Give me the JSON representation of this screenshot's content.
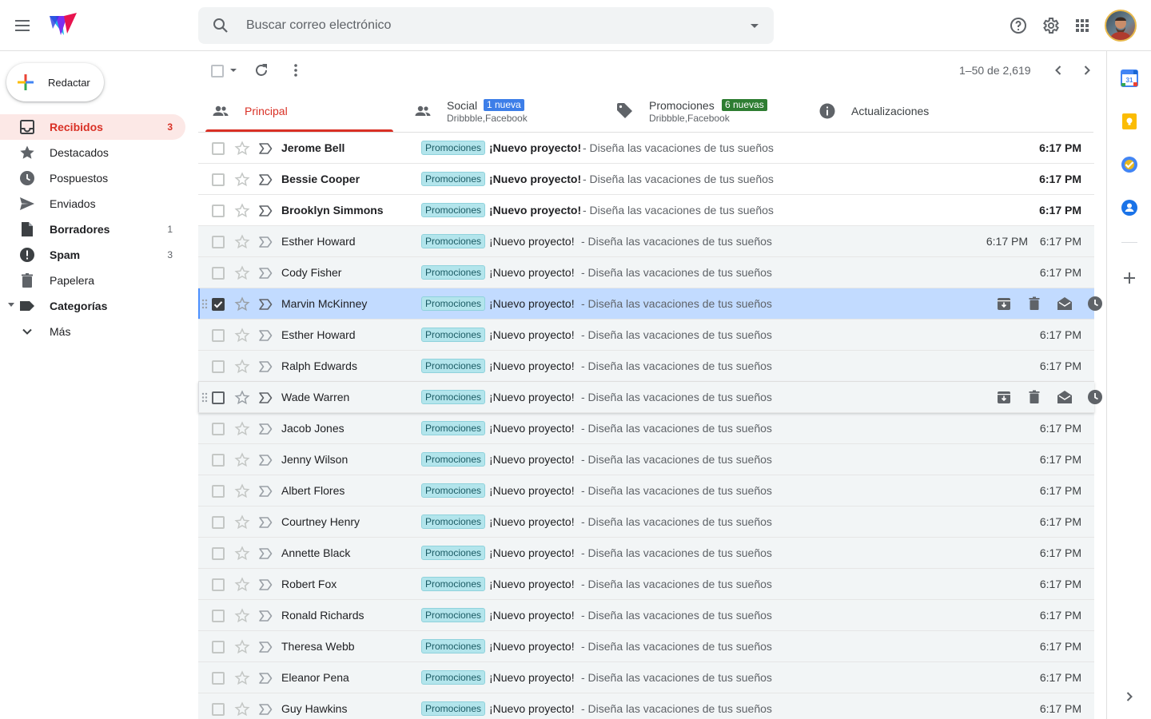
{
  "header": {
    "search_placeholder": "Buscar correo electrónico",
    "icons": [
      "menu-icon",
      "app-logo",
      "search-icon",
      "search-options-icon",
      "help-icon",
      "settings-icon",
      "apps-icon",
      "avatar"
    ]
  },
  "compose": {
    "label": "Redactar"
  },
  "nav": {
    "items": [
      {
        "label": "Recibidos",
        "count": "3",
        "icon": "inbox-icon",
        "active": true
      },
      {
        "label": "Destacados",
        "count": "",
        "icon": "star-icon"
      },
      {
        "label": "Pospuestos",
        "count": "",
        "icon": "clock-icon"
      },
      {
        "label": "Enviados",
        "count": "",
        "icon": "send-icon"
      },
      {
        "label": "Borradores",
        "count": "1",
        "icon": "draft-icon",
        "bold": true
      },
      {
        "label": "Spam",
        "count": "3",
        "icon": "spam-icon",
        "bold": true
      },
      {
        "label": "Papelera",
        "count": "",
        "icon": "trash-icon"
      },
      {
        "label": "Categorías",
        "count": "",
        "icon": "label-icon",
        "bold": true
      },
      {
        "label": "Más",
        "count": "",
        "icon": "expand-more-icon"
      }
    ]
  },
  "toolbar": {
    "pagination": "1–50 de 2,619"
  },
  "tabs": [
    {
      "label": "Principal",
      "sub": "",
      "badge": "",
      "icon": "people-icon",
      "active": true
    },
    {
      "label": "Social",
      "sub": "Dribbble,Facebook",
      "badge": "1 nueva",
      "badge_color": "#3d7ee8",
      "icon": "people-icon"
    },
    {
      "label": "Promociones",
      "sub": "Dribbble,Facebook",
      "badge": "6 nuevas",
      "badge_color": "#2e7d32",
      "icon": "tag-icon"
    },
    {
      "label": "Actualizaciones",
      "sub": "",
      "badge": "",
      "icon": "info-icon"
    }
  ],
  "emails": [
    {
      "sender": "Jerome Bell",
      "label": "Promociones",
      "subject": "¡Nuevo proyecto!",
      "snippet": "- Diseña las vacaciones de tus sueños",
      "time": "6:17 PM",
      "unread": true
    },
    {
      "sender": "Bessie Cooper",
      "label": "Promociones",
      "subject": "¡Nuevo proyecto!",
      "snippet": "- Diseña las vacaciones de tus sueños",
      "time": "6:17 PM",
      "unread": true
    },
    {
      "sender": "Brooklyn Simmons",
      "label": "Promociones",
      "subject": "¡Nuevo proyecto!",
      "snippet": "- Diseña las vacaciones de tus sueños",
      "time": "6:17 PM",
      "unread": true
    },
    {
      "sender": "Esther Howard",
      "label": "Promociones",
      "subject": "¡Nuevo proyecto!",
      "snippet": "- Diseña las vacaciones de tus sueños",
      "time": "6:17 PM",
      "time2": "6:17 PM"
    },
    {
      "sender": "Cody Fisher",
      "label": "Promociones",
      "subject": "¡Nuevo proyecto!",
      "snippet": "- Diseña las vacaciones de tus sueños",
      "time": "6:17 PM"
    },
    {
      "sender": "Marvin McKinney",
      "label": "Promociones",
      "subject": "¡Nuevo proyecto!",
      "snippet": "- Diseña las vacaciones de tus sueños",
      "time": "",
      "selected": true,
      "actions": true
    },
    {
      "sender": "Esther Howard",
      "label": "Promociones",
      "subject": "¡Nuevo proyecto!",
      "snippet": "- Diseña las vacaciones de tus sueños",
      "time": "6:17 PM"
    },
    {
      "sender": "Ralph Edwards",
      "label": "Promociones",
      "subject": "¡Nuevo proyecto!",
      "snippet": "- Diseña las vacaciones de tus sueños",
      "time": "6:17 PM"
    },
    {
      "sender": "Wade Warren",
      "label": "Promociones",
      "subject": "¡Nuevo proyecto!",
      "snippet": "- Diseña las vacaciones de tus sueños",
      "time": "",
      "hover": true,
      "actions": true
    },
    {
      "sender": "Jacob Jones",
      "label": "Promociones",
      "subject": "¡Nuevo proyecto!",
      "snippet": "- Diseña las vacaciones de tus sueños",
      "time": "6:17 PM"
    },
    {
      "sender": "Jenny Wilson",
      "label": "Promociones",
      "subject": "¡Nuevo proyecto!",
      "snippet": "- Diseña las vacaciones de tus sueños",
      "time": "6:17 PM"
    },
    {
      "sender": "Albert Flores",
      "label": "Promociones",
      "subject": "¡Nuevo proyecto!",
      "snippet": "- Diseña las vacaciones de tus sueños",
      "time": "6:17 PM"
    },
    {
      "sender": "Courtney Henry",
      "label": "Promociones",
      "subject": "¡Nuevo proyecto!",
      "snippet": "- Diseña las vacaciones de tus sueños",
      "time": "6:17 PM"
    },
    {
      "sender": "Annette Black",
      "label": "Promociones",
      "subject": "¡Nuevo proyecto!",
      "snippet": "- Diseña las vacaciones de tus sueños",
      "time": "6:17 PM"
    },
    {
      "sender": "Robert Fox",
      "label": "Promociones",
      "subject": "¡Nuevo proyecto!",
      "snippet": "- Diseña las vacaciones de tus sueños",
      "time": "6:17 PM"
    },
    {
      "sender": "Ronald Richards",
      "label": "Promociones",
      "subject": "¡Nuevo proyecto!",
      "snippet": "- Diseña las vacaciones de tus sueños",
      "time": "6:17 PM"
    },
    {
      "sender": "Theresa Webb",
      "label": "Promociones",
      "subject": "¡Nuevo proyecto!",
      "snippet": "- Diseña las vacaciones de tus sueños",
      "time": "6:17 PM"
    },
    {
      "sender": "Eleanor Pena",
      "label": "Promociones",
      "subject": "¡Nuevo proyecto!",
      "snippet": "- Diseña las vacaciones de tus sueños",
      "time": "6:17 PM"
    },
    {
      "sender": "Guy Hawkins",
      "label": "Promociones",
      "subject": "¡Nuevo proyecto!",
      "snippet": "- Diseña las vacaciones de tus sueños",
      "time": "6:17 PM"
    }
  ],
  "side_panel": {
    "icons": [
      "calendar-icon",
      "keep-icon",
      "tasks-icon",
      "contacts-icon",
      "add-icon",
      "expand-panel-icon"
    ],
    "calendar_day": "31"
  },
  "colors": {
    "accent": "#d93025",
    "selected_row": "#c2dbff",
    "label_chip": "#b3e5ec",
    "social_badge": "#3d7ee8",
    "promo_badge": "#2e7d32"
  }
}
